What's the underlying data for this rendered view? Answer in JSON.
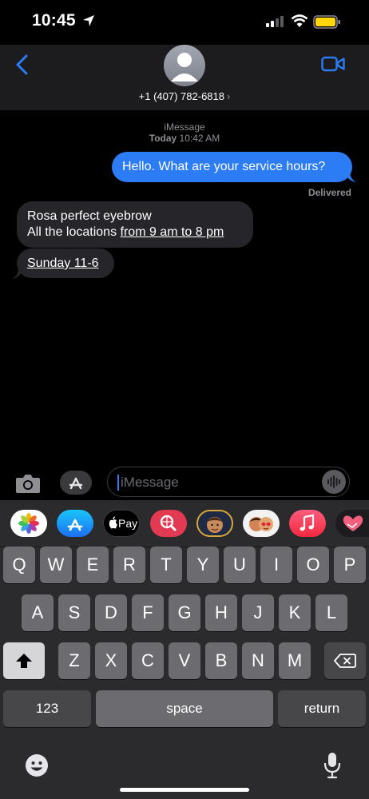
{
  "status_bar": {
    "time": "10:45"
  },
  "header": {
    "contact": "+1 (407) 782-6818",
    "chevron": "›"
  },
  "thread": {
    "service": "iMessage",
    "date_label": "Today",
    "time": "10:42 AM"
  },
  "messages": {
    "m1": {
      "text": "Hello. What are your service hours?",
      "status": "Delivered"
    },
    "m2": {
      "line1": "Rosa perfect eyebrow",
      "line2_prefix": "All the locations ",
      "line2_link": "from 9 am to 8 pm"
    },
    "m3": {
      "text": "Sunday 11-6"
    }
  },
  "composer": {
    "placeholder": "iMessage"
  },
  "app_drawer": {
    "items": [
      {
        "name": "photos-icon"
      },
      {
        "name": "app-store-icon"
      },
      {
        "name": "apple-pay-icon",
        "label": "Pay"
      },
      {
        "name": "images-search-icon"
      },
      {
        "name": "memoji-icon"
      },
      {
        "name": "memoji-stickers-icon"
      },
      {
        "name": "music-icon"
      },
      {
        "name": "digital-touch-icon"
      }
    ]
  },
  "keyboard": {
    "row1": [
      "Q",
      "W",
      "E",
      "R",
      "T",
      "Y",
      "U",
      "I",
      "O",
      "P"
    ],
    "row2": [
      "A",
      "S",
      "D",
      "F",
      "G",
      "H",
      "J",
      "K",
      "L"
    ],
    "row3": [
      "Z",
      "X",
      "C",
      "V",
      "B",
      "N",
      "M"
    ],
    "numbers_label": "123",
    "space_label": "space",
    "return_label": "return"
  },
  "colors": {
    "outgoing_bubble": "#2c7cf6",
    "incoming_bubble": "#26262a",
    "accent": "#2c7cf6"
  }
}
